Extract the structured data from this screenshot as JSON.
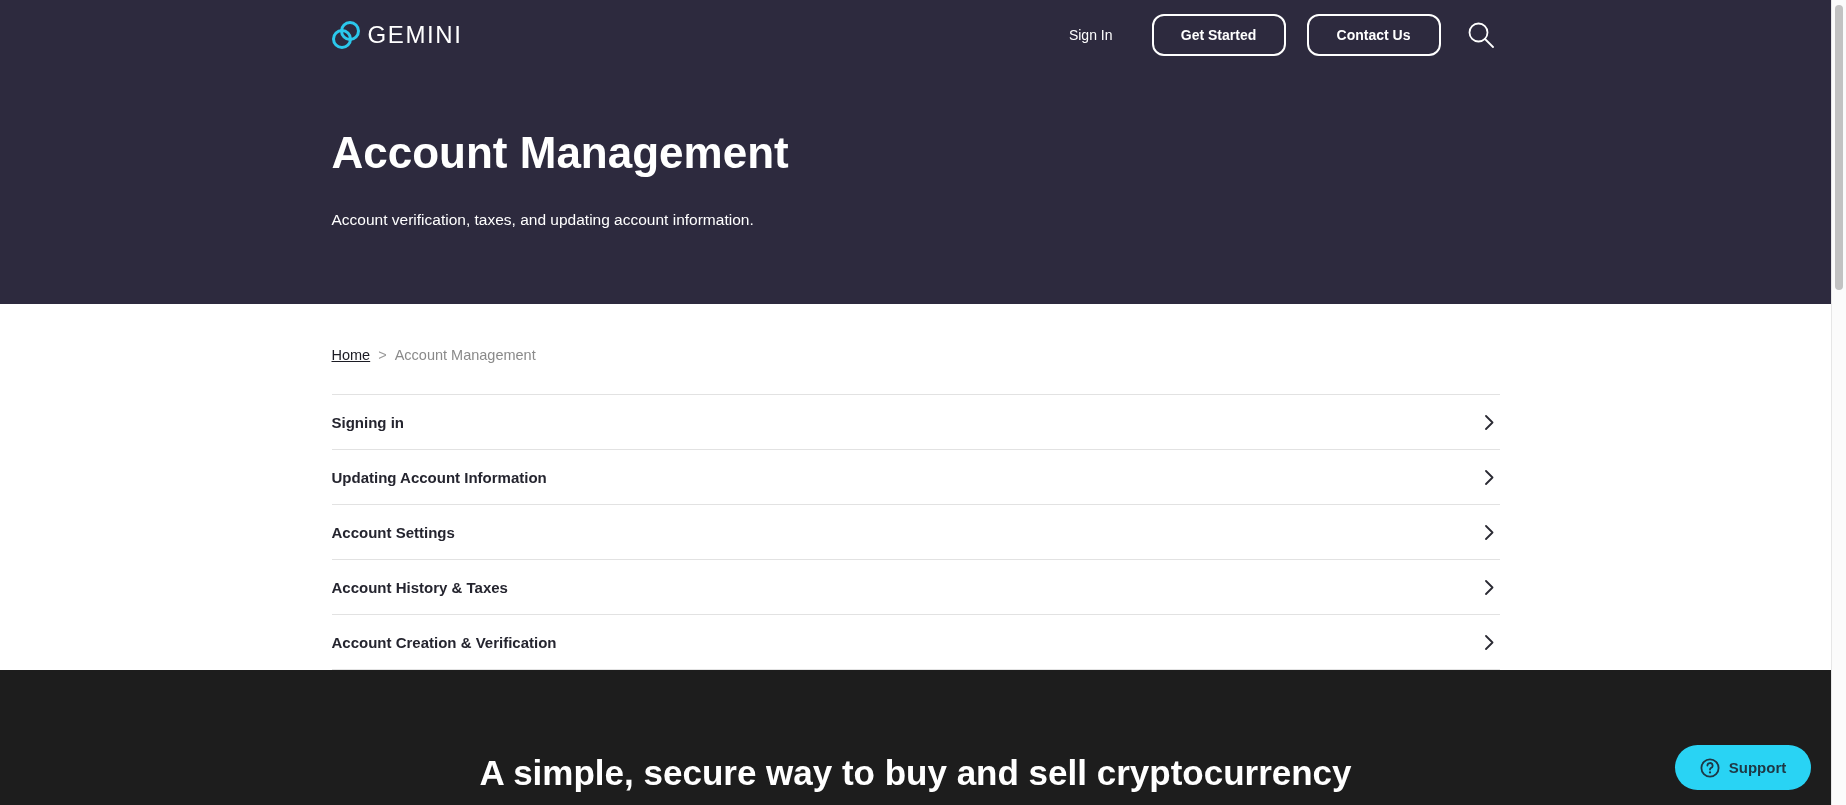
{
  "header": {
    "logo": "GEMINI",
    "nav": [
      {
        "label": "Sign In",
        "kind": "link"
      },
      {
        "label": "Get Started",
        "kind": "button"
      },
      {
        "label": "Contact Us",
        "kind": "button"
      }
    ]
  },
  "hero": {
    "title": "Account Management",
    "subtitle": "Account verification, taxes, and updating account information."
  },
  "breadcrumb": {
    "separator": ">",
    "items": [
      {
        "label": "Home",
        "kind": "link"
      },
      {
        "label": "Account Management",
        "kind": "current"
      }
    ]
  },
  "topics": [
    "Signing in",
    "Updating Account Information",
    "Account Settings",
    "Account History & Taxes",
    "Account Creation & Verification"
  ],
  "footer": {
    "headline": "A simple, secure way to buy and sell cryptocurrency"
  },
  "support_button": {
    "label": "Support"
  }
}
